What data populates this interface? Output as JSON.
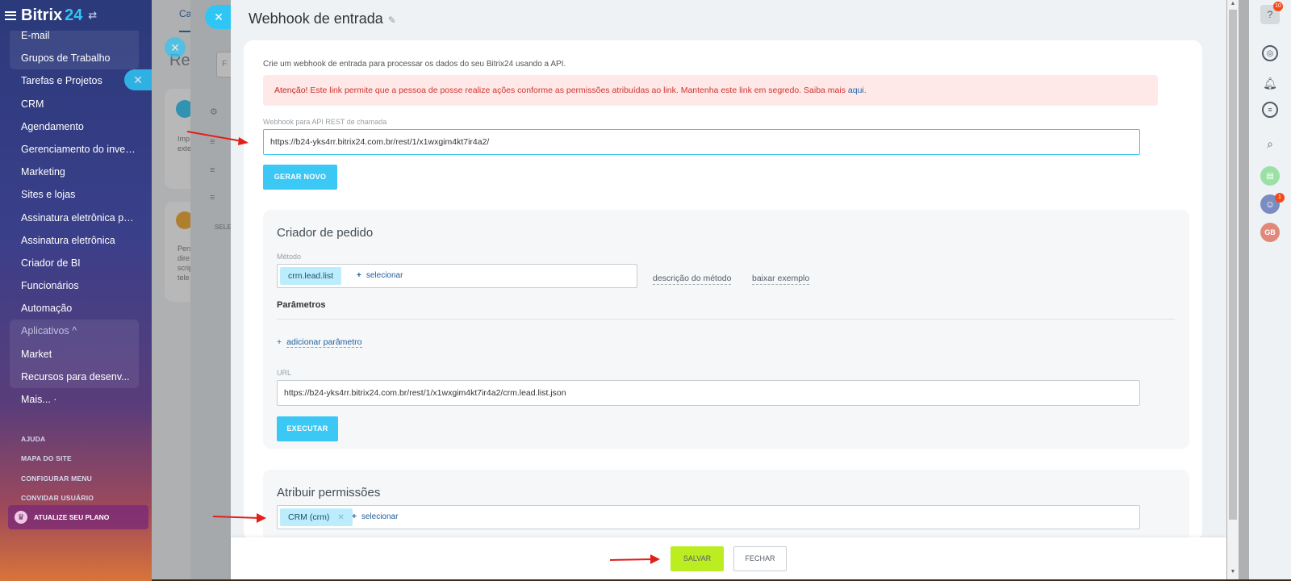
{
  "sidebar": {
    "logo_main": "Bitrix",
    "logo_num": "24",
    "items": [
      {
        "label": "E-mail"
      },
      {
        "label": "Grupos de Trabalho"
      },
      {
        "label": "Tarefas e Projetos"
      },
      {
        "label": "CRM"
      },
      {
        "label": "Agendamento"
      },
      {
        "label": "Gerenciamento do invent..."
      },
      {
        "label": "Marketing"
      },
      {
        "label": "Sites e lojas"
      },
      {
        "label": "Assinatura eletrônica para..."
      },
      {
        "label": "Assinatura eletrônica"
      },
      {
        "label": "Criador de BI"
      },
      {
        "label": "Funcionários"
      },
      {
        "label": "Automação"
      },
      {
        "label": "Aplicativos ^"
      },
      {
        "label": "Market"
      },
      {
        "label": "Recursos para desenv..."
      },
      {
        "label": "Mais... ·"
      }
    ],
    "bottom_links": [
      "AJUDA",
      "MAPA DO SITE",
      "CONFIGURAR MENU",
      "CONVIDAR USUÁRIO"
    ],
    "upgrade": "ATUALIZE SEU PLANO"
  },
  "background": {
    "tab_label": "Ca",
    "title_fragment": "Rec",
    "text_fragments": [
      "Imp",
      "exte",
      "Pers",
      "dire",
      "scrip",
      "tele",
      "SELE",
      "F"
    ]
  },
  "panel": {
    "title": "Webhook de entrada",
    "intro": "Crie um webhook de entrada para processar os dados do seu Bitrix24 usando a API.",
    "alert_prefix": "Atenção!",
    "alert_text": " Este link permite que a pessoa de posse realize ações conforme as permissões atribuídas ao link. Mantenha este link em segredo. Saiba mais ",
    "alert_link": "aqui",
    "alert_suffix": ".",
    "webhook_label": "Webhook para API REST de chamada",
    "webhook_url": "https://b24-yks4rr.bitrix24.com.br/rest/1/x1wxgim4kt7ir4a2/",
    "generate_button": "GERAR NOVO"
  },
  "request_builder": {
    "title": "Criador de pedido",
    "method_label": "Método",
    "method_tag": "crm.lead.list",
    "select_label": "selecionar",
    "method_description": "descrição do método",
    "download_example": "baixar exemplo",
    "params_title": "Parâmetros",
    "add_param": "adicionar parâmetro",
    "url_label": "URL",
    "url_value": "https://b24-yks4rr.bitrix24.com.br/rest/1/x1wxgim4kt7ir4a2/crm.lead.list.json",
    "execute_button": "EXECUTAR"
  },
  "permissions": {
    "title": "Atribuir permissões",
    "tag": "CRM (crm)",
    "select_label": "selecionar"
  },
  "footer": {
    "save": "SALVAR",
    "close": "FECHAR"
  },
  "rightbar": {
    "help_badge": "10",
    "avatar_badge": "1",
    "user_initials": "GB"
  },
  "colors": {
    "accent_blue": "#3bc8f5",
    "save_green": "#bbed21",
    "alert_red": "#d0342c",
    "annotation_arrow": "#e0201a"
  }
}
